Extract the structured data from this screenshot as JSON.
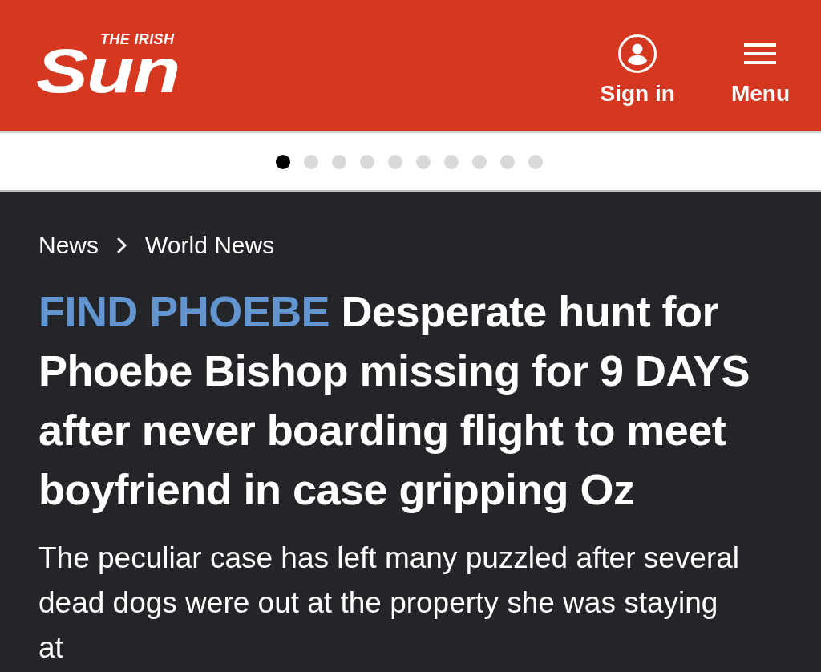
{
  "header": {
    "logo": {
      "tagline": "THE IRISH",
      "wordmark": "Sun"
    },
    "actions": [
      {
        "kind": "account",
        "label": "Sign in"
      },
      {
        "kind": "menu",
        "label": "Menu"
      }
    ]
  },
  "carousel_dots": [
    {
      "selected": true
    },
    {
      "selected": false
    },
    {
      "selected": false
    },
    {
      "selected": false
    },
    {
      "selected": false
    },
    {
      "selected": false
    },
    {
      "selected": false
    },
    {
      "selected": false
    },
    {
      "selected": false
    },
    {
      "selected": false
    }
  ],
  "article": {
    "breadcrumb": [
      "News",
      "World News"
    ],
    "headline": {
      "kicker": "FIND PHOEBE",
      "text": "Desperate hunt for Phoebe Bishop missing for 9 DAYS after never boarding flight to meet boyfriend in case gripping Oz"
    },
    "standfirst": "The peculiar case has left many puzzled after several dead dogs were out at the property she was staying at"
  }
}
